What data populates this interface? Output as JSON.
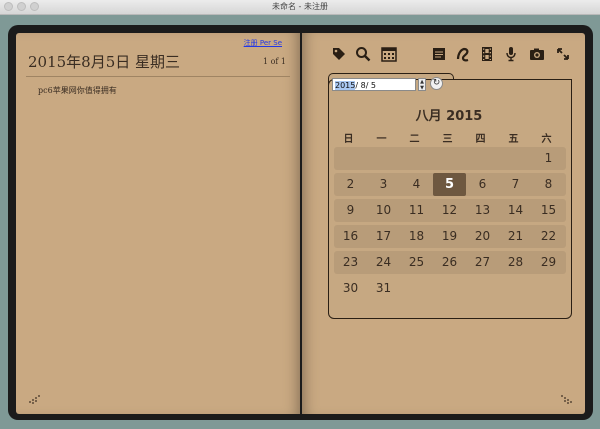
{
  "window": {
    "title": "未命名 - 未注册"
  },
  "left_page": {
    "date_heading": "2015年8月5日 星期三",
    "register_link": "注册 Per Se",
    "page_count": "1 of 1",
    "entry_text": "pc6苹果网你值得拥有"
  },
  "toolbar": {
    "icons": [
      "tag-icon",
      "search-icon",
      "calendar-icon",
      "notes-icon",
      "sketch-icon",
      "film-icon",
      "microphone-icon",
      "camera-icon",
      "expand-icon"
    ]
  },
  "calendar": {
    "date_field_year": "2015",
    "date_field_rest": "/  8/  5",
    "month_title": "八月 2015",
    "weekdays": [
      "日",
      "一",
      "二",
      "三",
      "四",
      "五",
      "六"
    ],
    "weeks": [
      [
        "",
        "",
        "",
        "",
        "",
        "",
        "1"
      ],
      [
        "2",
        "3",
        "4",
        "5",
        "6",
        "7",
        "8"
      ],
      [
        "9",
        "10",
        "11",
        "12",
        "13",
        "14",
        "15"
      ],
      [
        "16",
        "17",
        "18",
        "19",
        "20",
        "21",
        "22"
      ],
      [
        "23",
        "24",
        "25",
        "26",
        "27",
        "28",
        "29"
      ],
      [
        "30",
        "31",
        "",
        "",
        "",
        "",
        ""
      ]
    ],
    "selected_day": "5"
  }
}
